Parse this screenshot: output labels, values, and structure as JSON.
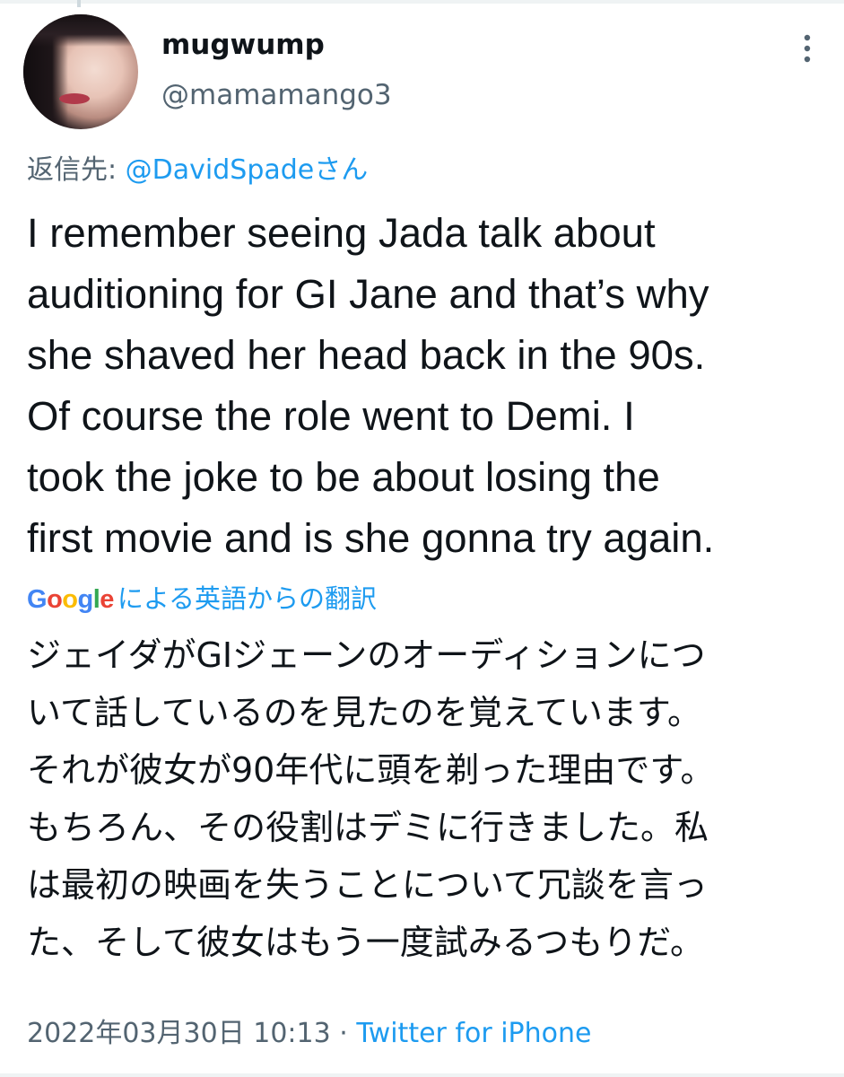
{
  "tweet": {
    "author_name": "mugwump",
    "author_handle": "@mamamango3",
    "reply_prefix": "返信先:",
    "reply_mention": "@DavidSpadeさん",
    "text_lines": [
      "I remember seeing Jada talk about",
      "auditioning for GI Jane and that’s why",
      "she shaved her head back in the 90s.",
      "Of course the role went to Demi. I",
      "took the joke to be about losing the",
      "first movie and is she gonna try again."
    ],
    "translation_provider": "Google",
    "translation_label": "による英語からの翻訳",
    "translation_lines": [
      "ジェイダがGIジェーンのオーディションにつ",
      "いて話しているのを見たのを覚えています。",
      "それが彼女が90年代に頭を剃った理由です。",
      "もちろん、その役割はデミに行きました。私",
      "は最初の映画を失うことについて冗談を言っ",
      "た、そして彼女はもう一度試みるつもりだ。"
    ],
    "timestamp": "2022年03月30日 10:13",
    "separator": "·",
    "source": "Twitter for iPhone"
  },
  "icons": {
    "avatar": "avatar-photo",
    "more": "more-vertical-icon"
  },
  "colors": {
    "text": "#0f1419",
    "secondary": "#536471",
    "link": "#1d9bf0"
  }
}
